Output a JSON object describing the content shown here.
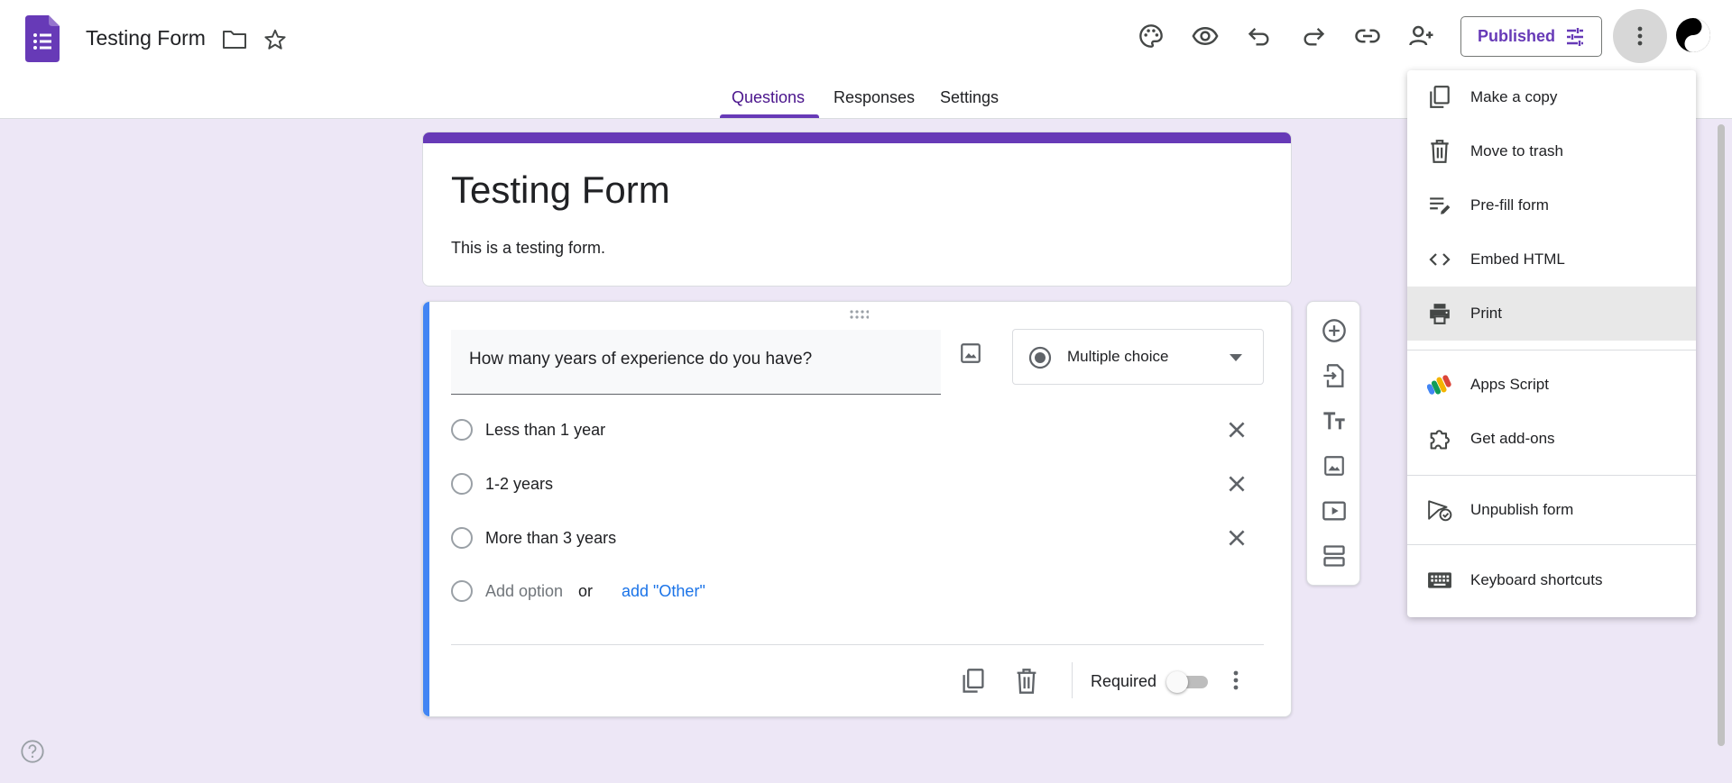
{
  "app": {
    "doc_title": "Testing Form",
    "published_label": "Published",
    "colors": {
      "accent": "#673ab7",
      "background": "#ede7f6",
      "question_accent": "#4285f4",
      "link": "#1a73e8"
    }
  },
  "header_icons": [
    "folder-icon",
    "star-icon",
    "palette-icon",
    "eye-icon",
    "undo-icon",
    "redo-icon",
    "link-icon",
    "add-person-icon",
    "tune-icon",
    "more-vert-icon",
    "avatar"
  ],
  "tabs": [
    {
      "label": "Questions",
      "active": true
    },
    {
      "label": "Responses",
      "active": false
    },
    {
      "label": "Settings",
      "active": false
    }
  ],
  "form": {
    "title": "Testing Form",
    "description": "This is a testing form."
  },
  "question": {
    "text": "How many years of experience do you have?",
    "type": "Multiple choice",
    "options": [
      "Less than 1 year",
      "1-2 years",
      "More than 3 years"
    ],
    "add_option": "Add option",
    "or_text": "or",
    "add_other": "add \"Other\"",
    "required_label": "Required",
    "required": false
  },
  "side_toolbar": [
    "add-question-icon",
    "import-questions-icon",
    "title-text-icon",
    "image-icon",
    "video-icon",
    "section-icon"
  ],
  "menu": {
    "items": [
      {
        "label": "Make a copy",
        "icon": "copy-icon"
      },
      {
        "label": "Move to trash",
        "icon": "trash-icon"
      },
      {
        "label": "Pre-fill form",
        "icon": "prefill-icon"
      },
      {
        "label": "Embed HTML",
        "icon": "code-icon"
      },
      {
        "label": "Print",
        "icon": "print-icon",
        "highlighted": true
      },
      {
        "label": "Apps Script",
        "icon": "apps-script-icon"
      },
      {
        "label": "Get add-ons",
        "icon": "puzzle-icon"
      },
      {
        "label": "Unpublish form",
        "icon": "unpublish-icon"
      },
      {
        "label": "Keyboard shortcuts",
        "icon": "keyboard-icon"
      }
    ]
  }
}
